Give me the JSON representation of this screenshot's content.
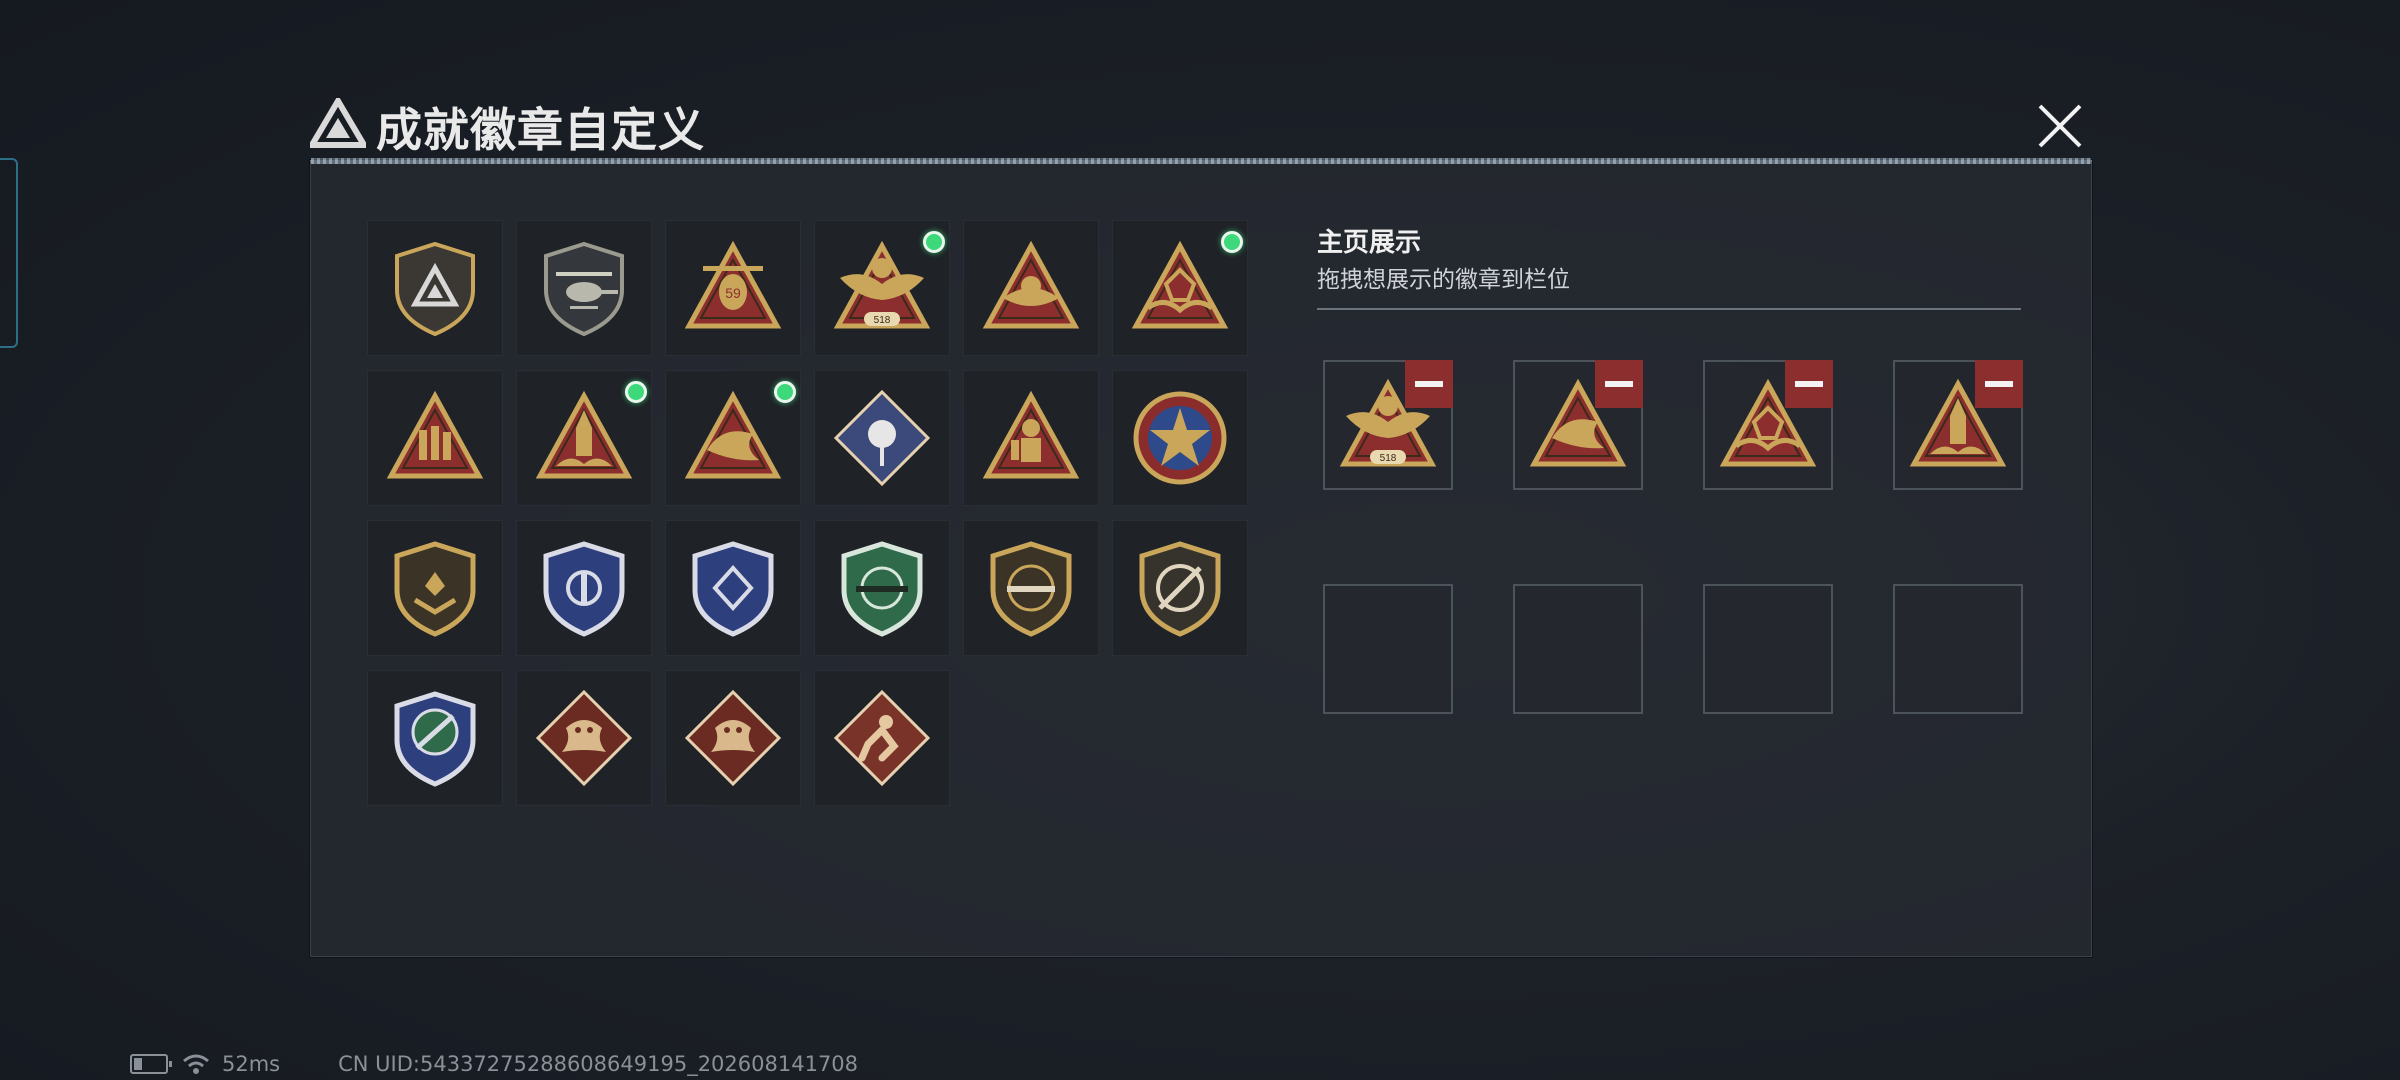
{
  "window": {
    "title": "成就徽章自定义"
  },
  "colors": {
    "gold": "#c9a65a",
    "dark_red": "#8d2e2e",
    "green_dot": "#3dd87a",
    "panel_bg": "#262a31"
  },
  "badges": [
    {
      "icon": "shield-triangle-badge",
      "new": false
    },
    {
      "icon": "helicopter-shield-badge",
      "new": false
    },
    {
      "icon": "helicopter-59-badge",
      "new": false
    },
    {
      "icon": "eagle-518-badge",
      "new": true
    },
    {
      "icon": "triangle-emblem-badge",
      "new": false
    },
    {
      "icon": "triangle-fist-badge",
      "new": true
    },
    {
      "icon": "triangle-soldiers-badge",
      "new": false
    },
    {
      "icon": "triangle-rocket-badge",
      "new": true
    },
    {
      "icon": "triangle-fish-badge",
      "new": true
    },
    {
      "icon": "diamond-rose-badge",
      "new": false
    },
    {
      "icon": "triangle-diver-badge",
      "new": false
    },
    {
      "icon": "star-medal-badge",
      "new": false
    },
    {
      "icon": "gold-shield-badge",
      "new": false
    },
    {
      "icon": "blue-shield-badge",
      "new": false
    },
    {
      "icon": "blue-diamond-shield-badge",
      "new": false
    },
    {
      "icon": "green-rifle-shield-badge",
      "new": false
    },
    {
      "icon": "rifle-shield-badge",
      "new": false
    },
    {
      "icon": "crosshair-shield-badge",
      "new": false
    },
    {
      "icon": "blue-crosshair-shield-badge",
      "new": false
    },
    {
      "icon": "dragon-diamond-badge",
      "new": false
    },
    {
      "icon": "dragon-diamond-badge-2",
      "new": false
    },
    {
      "icon": "runner-diamond-badge",
      "new": false
    }
  ],
  "display": {
    "title": "主页展示",
    "subtitle": "拖拽想展示的徽章到栏位",
    "slots": [
      {
        "icon": "eagle-518-badge",
        "filled": true
      },
      {
        "icon": "triangle-fish-badge",
        "filled": true
      },
      {
        "icon": "triangle-fist-badge",
        "filled": true
      },
      {
        "icon": "triangle-rocket-badge",
        "filled": true
      },
      {
        "filled": false
      },
      {
        "filled": false
      },
      {
        "filled": false
      },
      {
        "filled": false
      }
    ]
  },
  "status": {
    "ping": "52ms",
    "uid": "CN UID:54337275288608649195_202608141708"
  }
}
